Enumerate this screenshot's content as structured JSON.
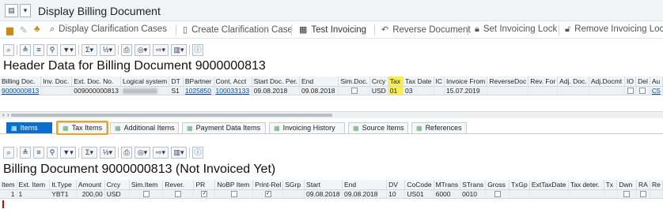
{
  "window": {
    "title": "Display Billing Document"
  },
  "app_toolbar": [
    {
      "label": "Display Clarification Cases",
      "icon": "magnifier-icon"
    },
    {
      "label": "Create Clarification Case",
      "icon": "document-icon"
    },
    {
      "label": "Test Invoicing",
      "icon": "calculator-icon"
    },
    {
      "label": "Reverse Document",
      "icon": "reverse-icon"
    },
    {
      "label": "Set Invoicing Lock",
      "icon": "lock-icon"
    },
    {
      "label": "Remove Invoicing Lock",
      "icon": "unlock-icon"
    }
  ],
  "header_section": {
    "title": "Header Data for Billing Document 9000000813",
    "columns": [
      "Billing Doc.",
      "Inv. Doc.",
      "Ext. Doc. No.",
      "Logical system",
      "DT",
      "BPartner",
      "Cont. Acct",
      "Start Doc. Per.",
      "End",
      "Sim.Doc.",
      "Crcy",
      "Tax",
      "Tax Date",
      "IC",
      "Invoice From",
      "ReverseDoc",
      "Rev. For",
      "Adj. Doc.",
      "Adj.Docmt",
      "IO",
      "Del",
      "Au"
    ],
    "row": {
      "billing_doc": "9000000813",
      "ext_doc_no": "009000000813",
      "dt": "S1",
      "bpartner": "1025850",
      "cont_acct": "100033133",
      "start_doc_per": "09.08.2018",
      "end": "09.08.2018",
      "crcy": "USD",
      "tax": "01",
      "tax_date": "03",
      "invoice_from": "15.07.2019",
      "au": "C5"
    }
  },
  "tabs": [
    "Items",
    "Tax Items",
    "Additional Items",
    "Payment Data Items",
    "Invoicing History",
    "Source Items",
    "References"
  ],
  "items_section": {
    "title": "Billing Document 9000000813 (Not Invoiced Yet)",
    "columns": [
      "Item",
      "Ext. Item",
      "It.Type",
      "Amount",
      "Crcy",
      "Sim.Item",
      "Rever.",
      "PR",
      "NoBP Item",
      "Print-Rel",
      "SGrp",
      "Start",
      "End",
      "DV",
      "CoCode",
      "MTrans",
      "STrans",
      "Gross",
      "TxGp",
      "ExtTaxDate",
      "Tax deter.",
      "Tx",
      "Dwn",
      "RA",
      "Re"
    ],
    "row": {
      "item": "1",
      "ext_item": "1",
      "it_type": "YBT1",
      "amount": "200,00",
      "crcy": "USD",
      "start": "09.08.2018",
      "end": "09.08.2018",
      "dv": "10",
      "cocode": "US01",
      "mtrans": "6000",
      "strans": "0010"
    }
  },
  "colors": {
    "accent": "#0a6ed1",
    "highlight_yellow": "#f9ef4c",
    "highlight_orange": "#f0a31a"
  }
}
